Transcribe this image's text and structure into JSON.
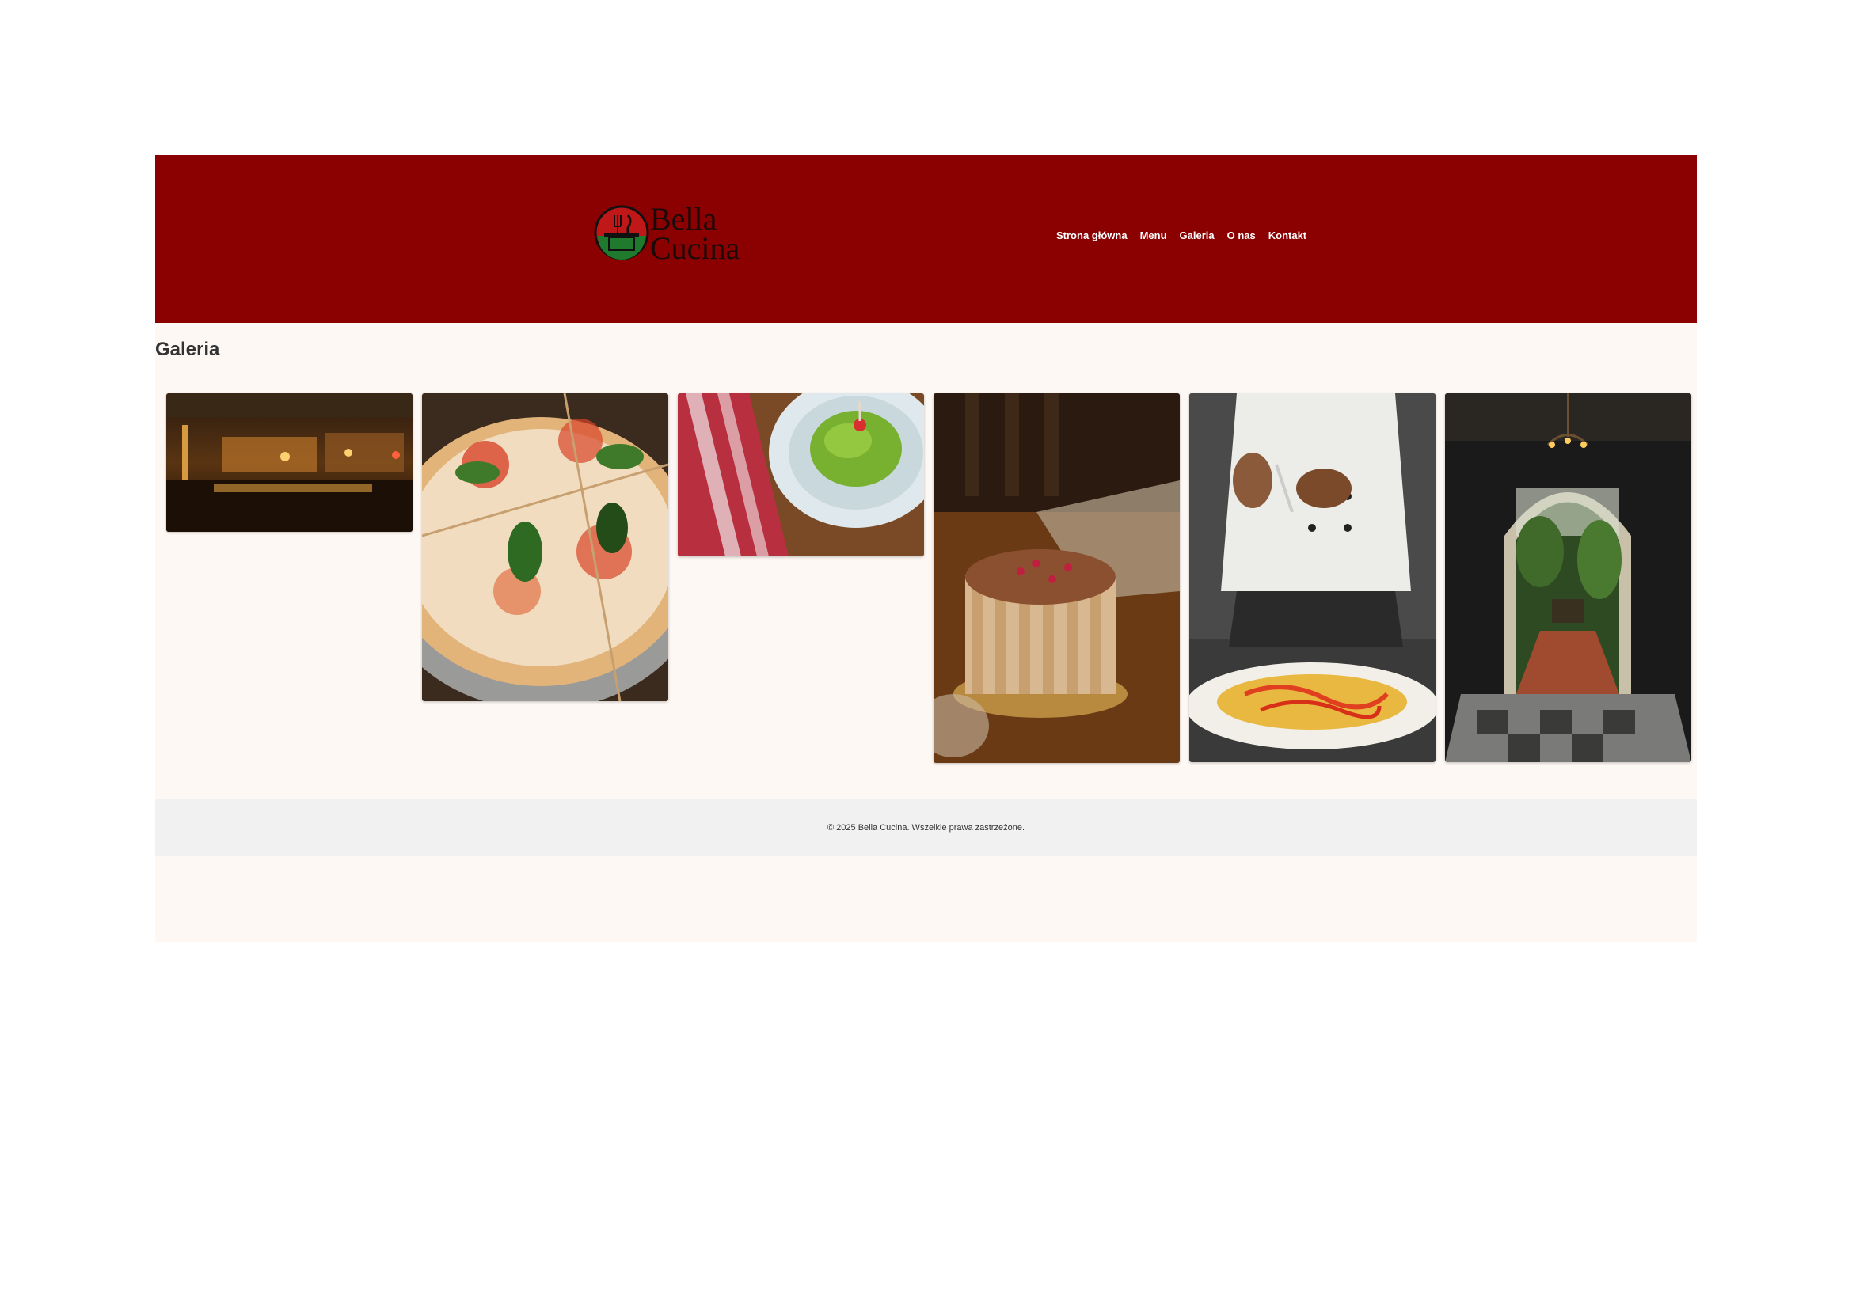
{
  "brand": {
    "name_line1": "Bella",
    "name_line2": "Cucina",
    "logo_icon": "fork-knife-table-emblem-icon"
  },
  "nav": {
    "items": [
      {
        "label": "Strona główna"
      },
      {
        "label": "Menu"
      },
      {
        "label": "Galeria"
      },
      {
        "label": "O nas"
      },
      {
        "label": "Kontakt"
      }
    ]
  },
  "main": {
    "title": "Galeria"
  },
  "gallery": {
    "images": [
      {
        "subject": "restaurant-interior"
      },
      {
        "subject": "margherita-pizza"
      },
      {
        "subject": "green-pasta"
      },
      {
        "subject": "charlotte-cake"
      },
      {
        "subject": "chef-preparing-pizza"
      },
      {
        "subject": "garden-courtyard"
      }
    ]
  },
  "footer": {
    "copyright": "© 2025 Bella Cucina. Wszelkie prawa zastrzeżone."
  },
  "colors": {
    "header_bg": "#8b0000",
    "page_bg": "#fef8f4",
    "footer_bg": "#f1f1f1",
    "nav_text": "#ffffff",
    "emblem_green": "#1f7a2e",
    "emblem_red": "#c01818"
  }
}
